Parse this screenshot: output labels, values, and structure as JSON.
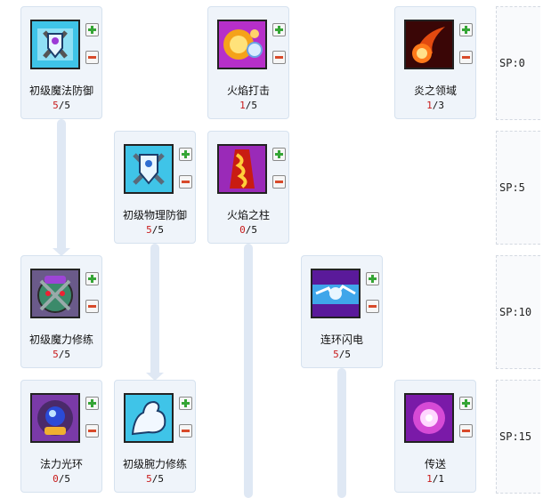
{
  "skills": [
    {
      "id": "mw",
      "name": "初级魔法防御",
      "level": "5",
      "max": "5",
      "icon": "magic-defense-icon"
    },
    {
      "id": "fb",
      "name": "火焰打击",
      "level": "1",
      "max": "5",
      "icon": "fire-strike-icon"
    },
    {
      "id": "fd",
      "name": "炎之领域",
      "level": "1",
      "max": "3",
      "icon": "flame-domain-icon"
    },
    {
      "id": "pd",
      "name": "初级物理防御",
      "level": "5",
      "max": "5",
      "icon": "physical-defense-icon"
    },
    {
      "id": "fp",
      "name": "火焰之柱",
      "level": "0",
      "max": "5",
      "icon": "fire-pillar-icon"
    },
    {
      "id": "mp",
      "name": "初级魔力修练",
      "level": "5",
      "max": "5",
      "icon": "magic-power-training-icon"
    },
    {
      "id": "cl",
      "name": "连环闪电",
      "level": "5",
      "max": "5",
      "icon": "chain-lightning-icon"
    },
    {
      "id": "ma",
      "name": "法力光环",
      "level": "0",
      "max": "5",
      "icon": "mana-aura-icon"
    },
    {
      "id": "ar",
      "name": "初级腕力修练",
      "level": "5",
      "max": "5",
      "icon": "arm-strength-icon"
    },
    {
      "id": "tp",
      "name": "传送",
      "level": "1",
      "max": "1",
      "icon": "teleport-icon"
    }
  ],
  "sp_rows": [
    "SP:0",
    "SP:5",
    "SP:10",
    "SP:15"
  ],
  "colors": {
    "card_bg": "#eff4fa",
    "level_current": "#c81a1a",
    "connector": "#dfe8f4",
    "plus": "#35a535",
    "minus": "#d84a2a"
  }
}
